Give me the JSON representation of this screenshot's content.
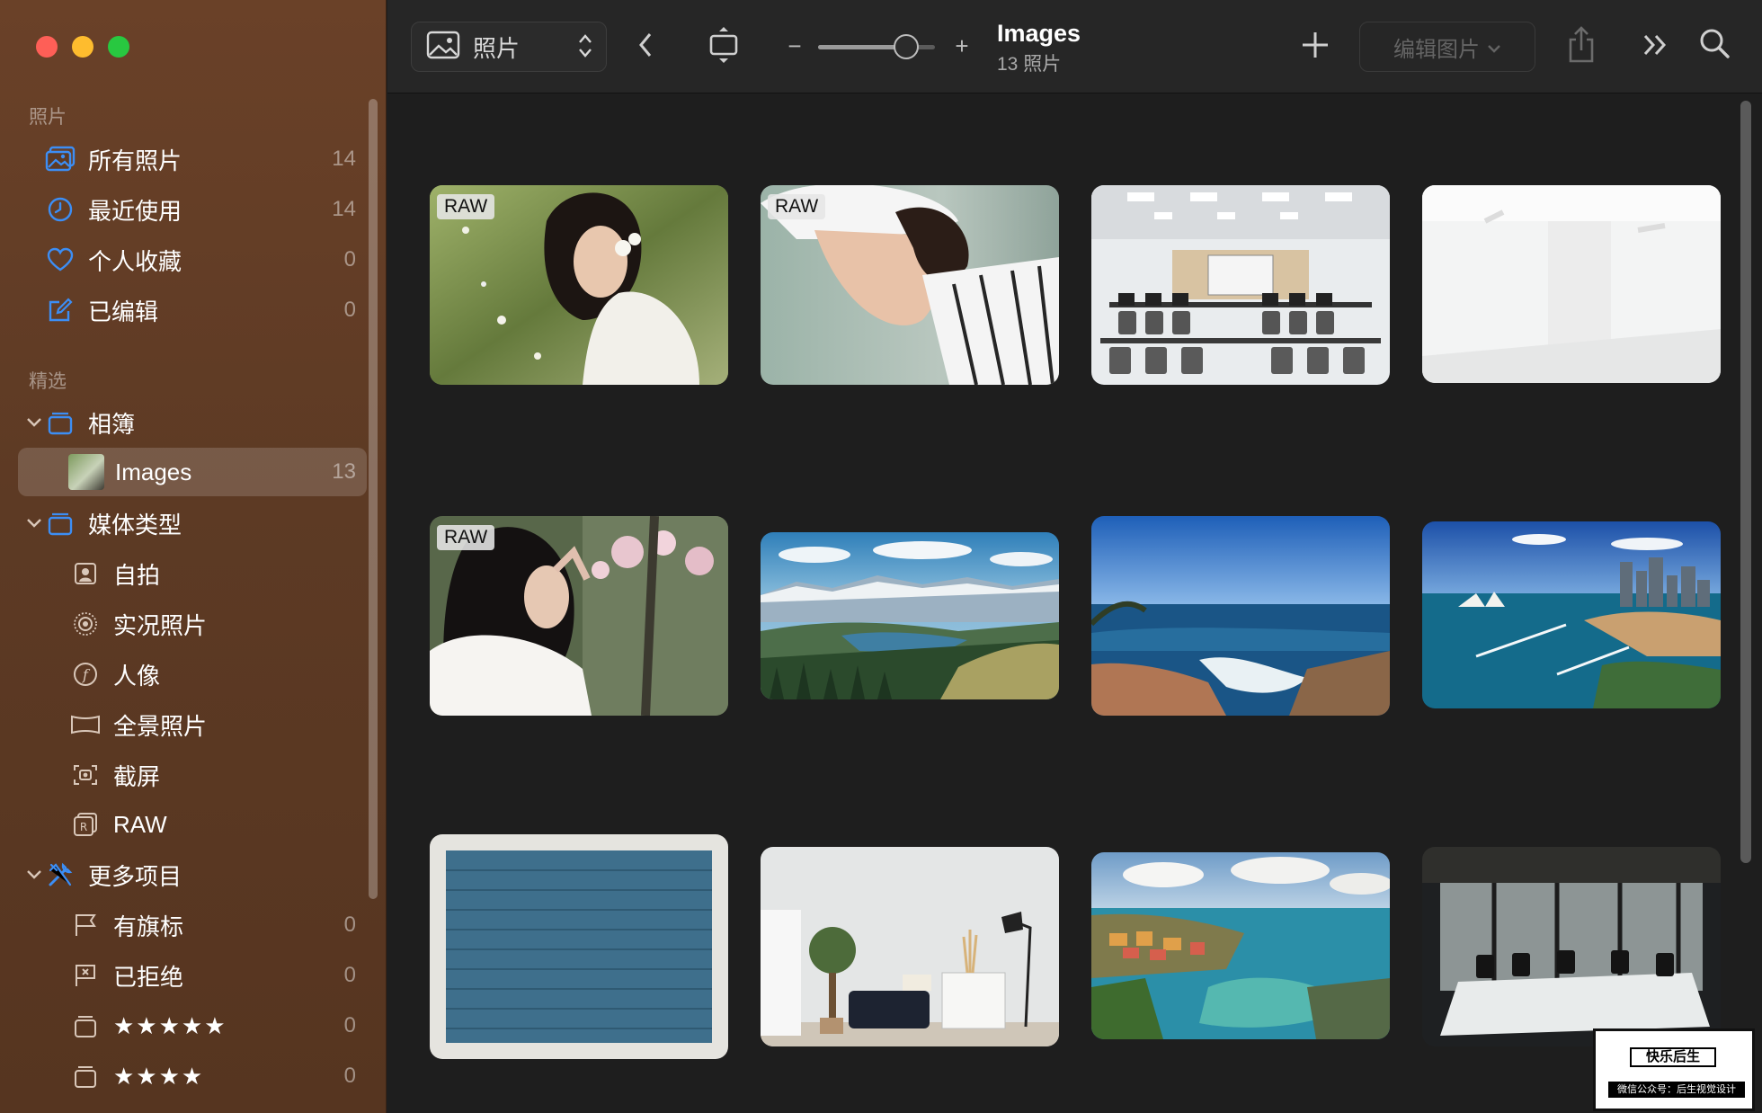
{
  "sidebar": {
    "section_photos": "照片",
    "items_library": [
      {
        "label": "所有照片",
        "count": "14"
      },
      {
        "label": "最近使用",
        "count": "14"
      },
      {
        "label": "个人收藏",
        "count": "0"
      },
      {
        "label": "已编辑",
        "count": "0"
      }
    ],
    "section_featured": "精选",
    "albums_label": "相簿",
    "images_label": "Images",
    "images_count": "13",
    "media_types_label": "媒体类型",
    "media_types": [
      "自拍",
      "实况照片",
      "人像",
      "全景照片",
      "截屏",
      "RAW"
    ],
    "more_items_label": "更多项目",
    "more_items": [
      {
        "label": "有旗标",
        "count": "0"
      },
      {
        "label": "已拒绝",
        "count": "0"
      },
      {
        "label": "★★★★★",
        "count": "0"
      },
      {
        "label": "★★★★",
        "count": "0"
      }
    ]
  },
  "toolbar": {
    "source_label": "照片",
    "title": "Images",
    "subtitle": "13 照片",
    "zoom_minus": "−",
    "zoom_plus": "+",
    "zoom_level": 0.75,
    "edit_label": "编辑图片"
  },
  "grid": {
    "raw_badge": "RAW",
    "photos": [
      {
        "name": "girl-in-flowers",
        "raw": true
      },
      {
        "name": "girl-in-cap",
        "raw": true
      },
      {
        "name": "computer-classroom",
        "raw": false
      },
      {
        "name": "white-room",
        "raw": false
      },
      {
        "name": "girl-with-blossoms",
        "raw": true
      },
      {
        "name": "mountain-valley",
        "raw": false
      },
      {
        "name": "ocean-coast",
        "raw": false
      },
      {
        "name": "sydney-harbour",
        "raw": false
      },
      {
        "name": "blue-brick-wall",
        "raw": false
      },
      {
        "name": "living-room",
        "raw": false
      },
      {
        "name": "coastal-village",
        "raw": false
      },
      {
        "name": "meeting-room",
        "raw": false
      }
    ]
  },
  "watermark": {
    "line1": "快乐后生",
    "line2": "微信公众号：后生视觉设计"
  },
  "colors": {
    "sidebar_bg": "#5d3a24",
    "accent_blue": "#3c8ef5",
    "main_bg": "#1e1e1e",
    "toolbar_bg": "#262626"
  }
}
